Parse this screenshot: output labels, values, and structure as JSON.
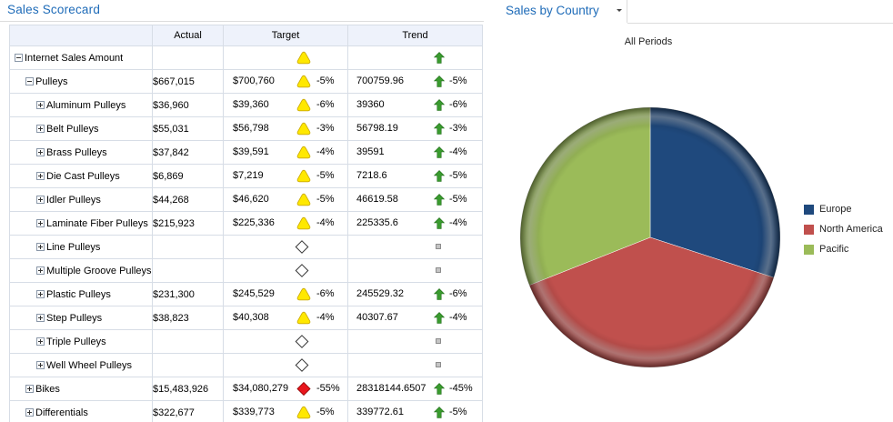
{
  "scorecard": {
    "title": "Sales Scorecard",
    "columns": [
      "",
      "Actual",
      "Target",
      "Trend"
    ],
    "rows": [
      {
        "name": "Internet Sales Amount",
        "level": 0,
        "expander": "minus",
        "actual": "",
        "target": "",
        "target_indicator": "yellow-triangle",
        "target_pct": "",
        "trend": "",
        "trend_indicator": "green-up-arrow",
        "trend_pct": ""
      },
      {
        "name": "Pulleys",
        "level": 1,
        "expander": "minus",
        "actual": "$667,015",
        "target": "$700,760",
        "target_indicator": "yellow-triangle",
        "target_pct": "-5%",
        "trend": "700759.96",
        "trend_indicator": "green-up-arrow",
        "trend_pct": "-5%"
      },
      {
        "name": "Aluminum Pulleys",
        "level": 2,
        "expander": "plus",
        "actual": "$36,960",
        "target": "$39,360",
        "target_indicator": "yellow-triangle",
        "target_pct": "-6%",
        "trend": "39360",
        "trend_indicator": "green-up-arrow",
        "trend_pct": "-6%"
      },
      {
        "name": "Belt Pulleys",
        "level": 2,
        "expander": "plus",
        "actual": "$55,031",
        "target": "$56,798",
        "target_indicator": "yellow-triangle",
        "target_pct": "-3%",
        "trend": "56798.19",
        "trend_indicator": "green-up-arrow",
        "trend_pct": "-3%"
      },
      {
        "name": "Brass Pulleys",
        "level": 2,
        "expander": "plus",
        "actual": "$37,842",
        "target": "$39,591",
        "target_indicator": "yellow-triangle",
        "target_pct": "-4%",
        "trend": "39591",
        "trend_indicator": "green-up-arrow",
        "trend_pct": "-4%"
      },
      {
        "name": "Die Cast Pulleys",
        "level": 2,
        "expander": "plus",
        "actual": "$6,869",
        "target": "$7,219",
        "target_indicator": "yellow-triangle",
        "target_pct": "-5%",
        "trend": "7218.6",
        "trend_indicator": "green-up-arrow",
        "trend_pct": "-5%"
      },
      {
        "name": "Idler Pulleys",
        "level": 2,
        "expander": "plus",
        "actual": "$44,268",
        "target": "$46,620",
        "target_indicator": "yellow-triangle",
        "target_pct": "-5%",
        "trend": "46619.58",
        "trend_indicator": "green-up-arrow",
        "trend_pct": "-5%"
      },
      {
        "name": "Laminate Fiber Pulleys",
        "level": 2,
        "expander": "plus",
        "actual": "$215,923",
        "target": "$225,336",
        "target_indicator": "yellow-triangle",
        "target_pct": "-4%",
        "trend": "225335.6",
        "trend_indicator": "green-up-arrow",
        "trend_pct": "-4%"
      },
      {
        "name": "Line Pulleys",
        "level": 2,
        "expander": "plus",
        "actual": "",
        "target": "",
        "target_indicator": "empty-diamond",
        "target_pct": "",
        "trend": "",
        "trend_indicator": "grey-square",
        "trend_pct": ""
      },
      {
        "name": "Multiple Groove Pulleys",
        "level": 2,
        "expander": "plus",
        "actual": "",
        "target": "",
        "target_indicator": "empty-diamond",
        "target_pct": "",
        "trend": "",
        "trend_indicator": "grey-square",
        "trend_pct": ""
      },
      {
        "name": "Plastic Pulleys",
        "level": 2,
        "expander": "plus",
        "actual": "$231,300",
        "target": "$245,529",
        "target_indicator": "yellow-triangle",
        "target_pct": "-6%",
        "trend": "245529.32",
        "trend_indicator": "green-up-arrow",
        "trend_pct": "-6%"
      },
      {
        "name": "Step Pulleys",
        "level": 2,
        "expander": "plus",
        "actual": "$38,823",
        "target": "$40,308",
        "target_indicator": "yellow-triangle",
        "target_pct": "-4%",
        "trend": "40307.67",
        "trend_indicator": "green-up-arrow",
        "trend_pct": "-4%"
      },
      {
        "name": "Triple Pulleys",
        "level": 2,
        "expander": "plus",
        "actual": "",
        "target": "",
        "target_indicator": "empty-diamond",
        "target_pct": "",
        "trend": "",
        "trend_indicator": "grey-square",
        "trend_pct": ""
      },
      {
        "name": "Well Wheel Pulleys",
        "level": 2,
        "expander": "plus",
        "actual": "",
        "target": "",
        "target_indicator": "empty-diamond",
        "target_pct": "",
        "trend": "",
        "trend_indicator": "grey-square",
        "trend_pct": ""
      },
      {
        "name": "Bikes",
        "level": 1,
        "expander": "plus",
        "actual": "$15,483,926",
        "target": "$34,080,279",
        "target_indicator": "red-diamond",
        "target_pct": "-55%",
        "trend": "28318144.6507",
        "trend_indicator": "green-up-arrow",
        "trend_pct": "-45%"
      },
      {
        "name": "Differentials",
        "level": 1,
        "expander": "plus",
        "actual": "$322,677",
        "target": "$339,773",
        "target_indicator": "yellow-triangle",
        "target_pct": "-5%",
        "trend": "339772.61",
        "trend_indicator": "green-up-arrow",
        "trend_pct": "-5%"
      }
    ]
  },
  "report": {
    "title": "Sales by Country",
    "menu_icon": "dropdown-arrow-icon"
  },
  "chart_data": {
    "type": "pie",
    "title": "All Periods",
    "categories": [
      "Europe",
      "North America",
      "Pacific"
    ],
    "values": [
      30,
      39,
      31
    ],
    "colors": [
      "#1f497d",
      "#c0504d",
      "#9bbb59"
    ],
    "legend": "right"
  },
  "colors": {
    "title_blue": "#1e6bb8",
    "header_bg": "#eef2fb",
    "grid_line": "#d7dde6",
    "indicator_yellow": "#ffe800",
    "indicator_red": "#e8161d",
    "indicator_green": "#3a9b2f"
  }
}
